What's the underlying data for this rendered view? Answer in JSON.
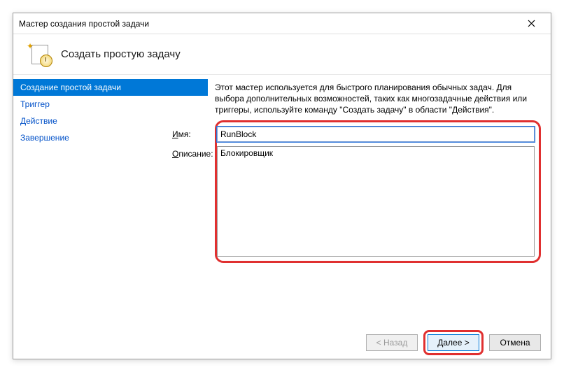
{
  "window": {
    "title": "Мастер создания простой задачи"
  },
  "header": {
    "title": "Создать простую задачу"
  },
  "sidebar": {
    "steps": [
      {
        "label": "Создание простой задачи",
        "active": true
      },
      {
        "label": "Триггер",
        "active": false
      },
      {
        "label": "Действие",
        "active": false
      },
      {
        "label": "Завершение",
        "active": false
      }
    ]
  },
  "main": {
    "intro": "Этот мастер используется для быстрого планирования обычных задач.  Для выбора дополнительных возможностей, таких как многозадачные действия или триггеры, используйте команду \"Создать задачу\" в области \"Действия\".",
    "name_label_u": "И",
    "name_label_rest": "мя:",
    "name_value": "RunBlock",
    "desc_label_u": "О",
    "desc_label_rest": "писание:",
    "desc_value": "Блокировщик"
  },
  "footer": {
    "back": "< Назад",
    "next": "Далее >",
    "cancel": "Отмена"
  }
}
